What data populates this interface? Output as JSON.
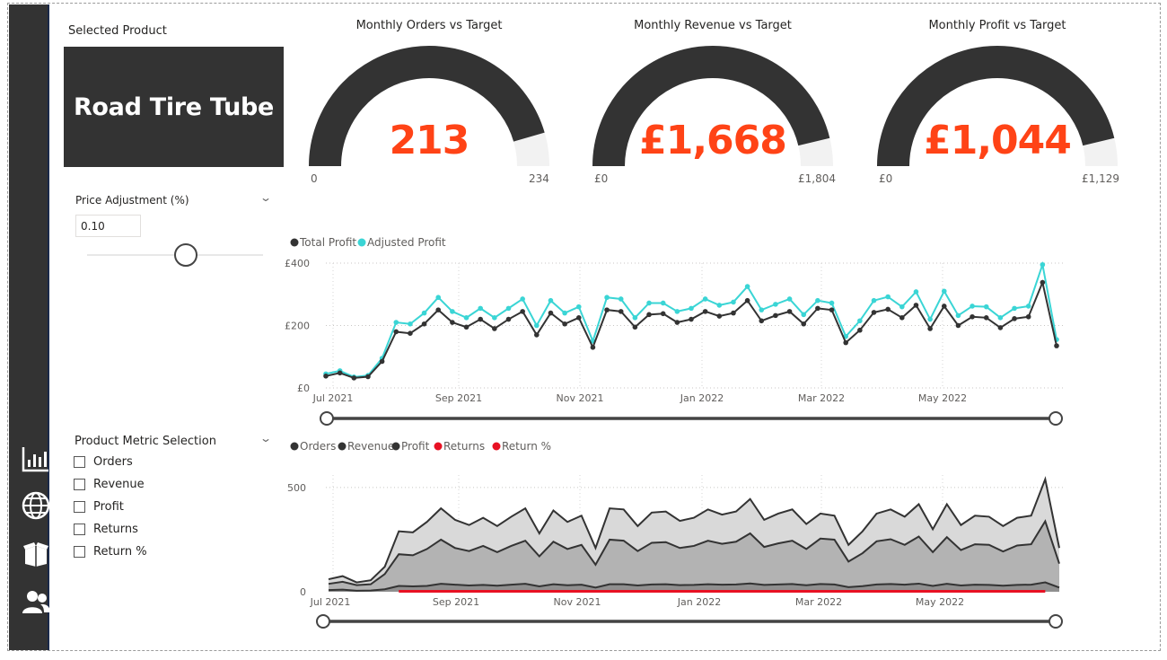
{
  "nav": {
    "icons": [
      "chart-icon",
      "globe-icon",
      "box-icon",
      "users-icon"
    ]
  },
  "selected_product": {
    "label": "Selected Product",
    "name": "Road Tire Tube"
  },
  "price_adjustment": {
    "title": "Price Adjustment (%)",
    "value": "0.10",
    "slider_fraction": 0.55
  },
  "metric_selection": {
    "title": "Product Metric Selection",
    "options": [
      "Orders",
      "Revenue",
      "Profit",
      "Returns",
      "Return %"
    ]
  },
  "gauges": [
    {
      "title": "Monthly Orders vs Target",
      "value": "213",
      "min": "0",
      "max": "234",
      "fraction": 0.91
    },
    {
      "title": "Monthly Revenue vs Target",
      "value": "£1,668",
      "min": "£0",
      "max": "£1,804",
      "fraction": 0.925
    },
    {
      "title": "Monthly Profit vs Target",
      "value": "£1,044",
      "min": "£0",
      "max": "£1,129",
      "fraction": 0.925
    }
  ],
  "colors": {
    "dark": "#333333",
    "accent": "#ff4316",
    "teal": "#3ad5d5",
    "returns_red": "#e81123",
    "gauge_bg": "#f2f2f2"
  },
  "chart_data": [
    {
      "type": "line",
      "legend": [
        "Total Profit",
        "Adjusted Profit"
      ],
      "x_ticks": [
        "Jul 2021",
        "Sep 2021",
        "Nov 2021",
        "Jan 2022",
        "Mar 2022",
        "May 2022"
      ],
      "y_ticks": [
        "£400",
        "£200",
        "£0"
      ],
      "ylim": [
        0,
        400
      ],
      "series": [
        {
          "name": "Total Profit",
          "color": "#333333",
          "values": [
            38,
            48,
            32,
            36,
            85,
            180,
            175,
            205,
            250,
            210,
            195,
            220,
            190,
            220,
            245,
            170,
            240,
            205,
            225,
            130,
            250,
            245,
            195,
            235,
            238,
            210,
            220,
            245,
            230,
            240,
            280,
            215,
            232,
            245,
            205,
            255,
            250,
            145,
            185,
            242,
            252,
            225,
            265,
            190,
            262,
            200,
            228,
            225,
            193,
            222,
            228,
            338,
            135
          ]
        },
        {
          "name": "Adjusted Profit",
          "color": "#3ad5d5",
          "values": [
            45,
            55,
            35,
            40,
            95,
            210,
            205,
            240,
            290,
            245,
            225,
            255,
            225,
            255,
            285,
            200,
            280,
            240,
            260,
            150,
            290,
            285,
            225,
            272,
            272,
            245,
            255,
            285,
            265,
            275,
            325,
            250,
            268,
            285,
            235,
            280,
            272,
            165,
            215,
            280,
            292,
            260,
            308,
            220,
            310,
            232,
            262,
            260,
            225,
            255,
            262,
            395,
            155
          ]
        }
      ],
      "range_slider": [
        0,
        1
      ]
    },
    {
      "type": "area",
      "legend": [
        "Orders",
        "Revenue",
        "Profit",
        "Returns",
        "Return %"
      ],
      "x_ticks": [
        "Jul 2021",
        "Sep 2021",
        "Nov 2021",
        "Jan 2022",
        "Mar 2022",
        "May 2022"
      ],
      "y_ticks": [
        "500",
        "0"
      ],
      "ylim": [
        0,
        560
      ],
      "series": [
        {
          "name": "Orders",
          "color": "#333333",
          "values": [
            8,
            10,
            5,
            6,
            12,
            28,
            26,
            28,
            38,
            34,
            30,
            33,
            29,
            34,
            38,
            26,
            36,
            31,
            34,
            20,
            36,
            36,
            30,
            35,
            36,
            32,
            33,
            36,
            34,
            35,
            40,
            33,
            35,
            37,
            31,
            37,
            35,
            22,
            27,
            35,
            37,
            34,
            39,
            28,
            38,
            30,
            34,
            33,
            29,
            33,
            34,
            45,
            20
          ]
        },
        {
          "name": "Revenue",
          "color": "#333333",
          "values": [
            60,
            75,
            45,
            55,
            120,
            290,
            285,
            335,
            400,
            345,
            320,
            355,
            315,
            360,
            400,
            280,
            390,
            335,
            365,
            210,
            400,
            395,
            315,
            380,
            385,
            340,
            355,
            395,
            370,
            385,
            445,
            345,
            375,
            395,
            325,
            375,
            365,
            225,
            290,
            375,
            395,
            360,
            420,
            300,
            420,
            320,
            365,
            360,
            315,
            355,
            365,
            540,
            210
          ]
        },
        {
          "name": "Profit",
          "color": "#333333",
          "values": [
            38,
            48,
            32,
            36,
            85,
            180,
            175,
            205,
            250,
            210,
            195,
            220,
            190,
            220,
            245,
            170,
            240,
            205,
            225,
            130,
            250,
            245,
            195,
            235,
            238,
            210,
            220,
            245,
            230,
            240,
            280,
            215,
            232,
            245,
            205,
            255,
            250,
            145,
            185,
            242,
            252,
            225,
            265,
            190,
            262,
            200,
            228,
            225,
            193,
            222,
            228,
            338,
            135
          ]
        },
        {
          "name": "Returns",
          "color": "#e81123",
          "values": [
            0,
            0,
            0,
            0,
            0,
            1,
            1,
            1,
            1,
            1,
            1,
            1,
            1,
            1,
            1,
            1,
            1,
            1,
            1,
            1,
            1,
            1,
            1,
            1,
            1,
            1,
            1,
            1,
            1,
            1,
            1,
            1,
            1,
            1,
            1,
            1,
            1,
            1,
            1,
            1,
            1,
            1,
            1,
            1,
            1,
            1,
            1,
            1,
            1,
            1,
            1,
            1,
            0
          ]
        },
        {
          "name": "Return %",
          "color": "#e81123",
          "values": []
        }
      ],
      "range_slider": [
        0,
        1
      ]
    }
  ]
}
